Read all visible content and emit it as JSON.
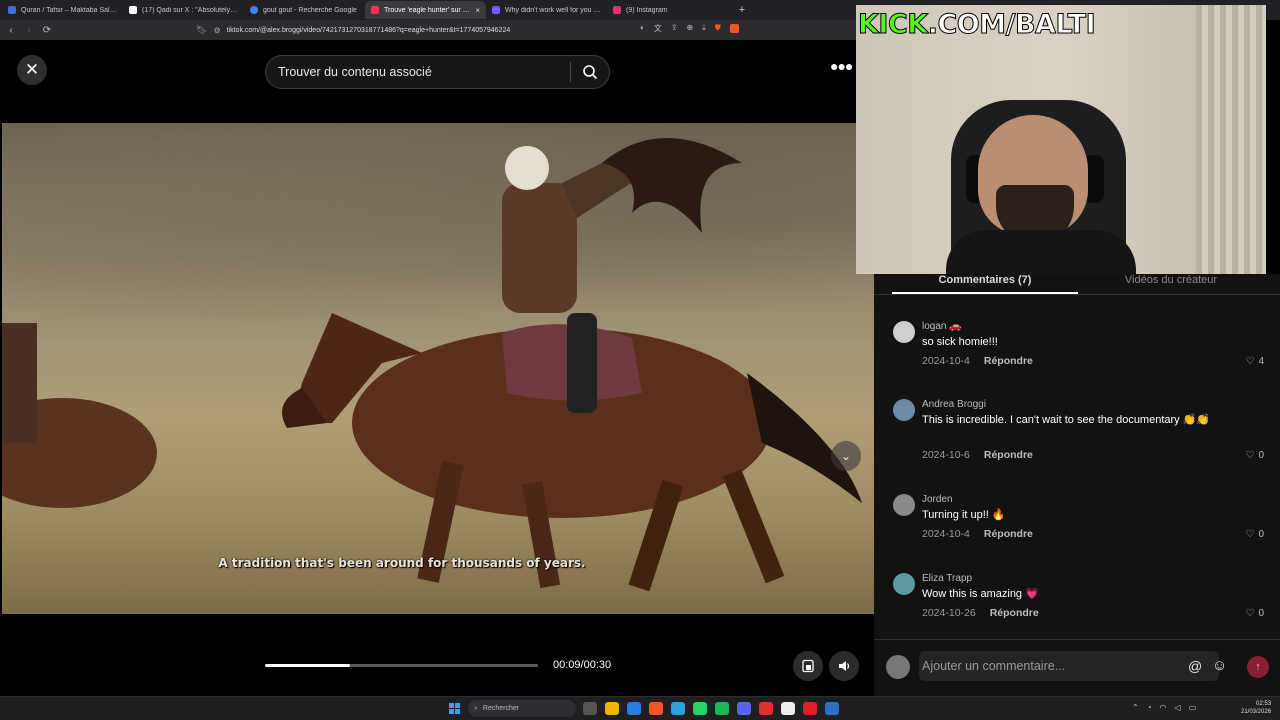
{
  "browser": {
    "tabs": [
      {
        "title": "Quran / Tafsir – Maktaba Saliha",
        "favicon_color": "#3b6fd6"
      },
      {
        "title": "(17) Qadi sur X : \"Absolutely outrage",
        "favicon_color": "#ffffff"
      },
      {
        "title": "gout gout - Recherche Google",
        "favicon_color": "#4285f4"
      },
      {
        "title": "Trouve 'eagle hunter' sur TikTok",
        "favicon_color": "#ff2d55"
      },
      {
        "title": "Why didn't work well for you ? What",
        "favicon_color": "#7c5cff"
      },
      {
        "title": "(9) Instagram",
        "favicon_color": "#e1306c"
      }
    ],
    "active_tab": 3,
    "tab_close": "×",
    "new_tab": "+",
    "url": "tiktok.com/@alex.broggi/video/7421731270318771486?q=eagle+hunter&t=1774057946224"
  },
  "overlay": {
    "kick_brand": "KICK",
    "kick_rest": ".COM/BALTI",
    "brand_color": "#53fc18"
  },
  "search": {
    "placeholder": "Trouver du contenu associé"
  },
  "video": {
    "subtitle": "A tradition that's been around for thousands of years.",
    "progress_fraction": 0.31,
    "time": "00:09/00:30"
  },
  "panel": {
    "tabs": [
      "Commentaires (7)",
      "Vidéos du créateur"
    ],
    "reply_label": "Répondre",
    "comments": [
      {
        "user": "logan 🚗",
        "text": "so sick homie!!!",
        "date": "2024-10-4",
        "likes": "4",
        "avatar_color": "#cfcfcf"
      },
      {
        "user": "Andrea Broggi",
        "text": "This is incredible. I can't wait to see the documentary 👏👏",
        "date": "2024-10-6",
        "likes": "0",
        "avatar_color": "#6f8aa6"
      },
      {
        "user": "Jorden",
        "text": "Turning it up!! 🔥",
        "date": "2024-10-4",
        "likes": "0",
        "avatar_color": "#8a8a8a"
      },
      {
        "user": "Eliza Trapp",
        "text": "Wow this is amazing 💗",
        "date": "2024-10-26",
        "likes": "0",
        "avatar_color": "#5f9aa0"
      }
    ],
    "input_placeholder": "Ajouter un commentaire..."
  },
  "taskbar": {
    "search_placeholder": "Rechercher",
    "time": "02:53",
    "date": "21/03/2026",
    "app_colors": [
      "#555555",
      "#f0b400",
      "#2a7de1",
      "#fb542b",
      "#2aa4e0",
      "#25d366",
      "#1db954",
      "#5865f2",
      "#e03030",
      "#eeeeee",
      "#e11d2a",
      "#2a70c8"
    ]
  }
}
